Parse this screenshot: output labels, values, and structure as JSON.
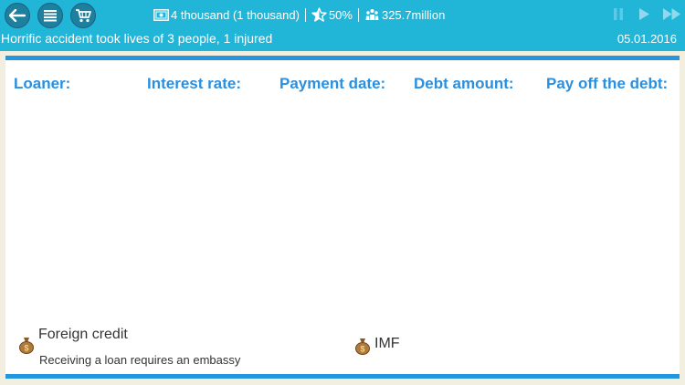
{
  "header": {
    "money": "4 thousand (1 thousand)",
    "approval": "50%",
    "population": "325.7million",
    "news": "Horrific accident took lives of 3 people, 1 injured",
    "date": "05.01.2016",
    "icons": [
      "back-arrow-icon",
      "menu-icon",
      "cart-icon",
      "money-icon",
      "star-icon",
      "people-icon",
      "pause-icon",
      "play-icon",
      "fast-forward-icon"
    ]
  },
  "columns": [
    "Loaner:",
    "Interest rate:",
    "Payment date:",
    "Debt amount:",
    "Pay off the debt:"
  ],
  "lenders": [
    {
      "name": "Foreign credit",
      "note": "Receiving a loan requires an embassy",
      "icon": "money-bag-icon"
    },
    {
      "name": "IMF",
      "icon": "money-bag-icon"
    }
  ],
  "colors": {
    "topbar": "#21b6d8",
    "accent": "#2596de",
    "header_text": "#2b8fde",
    "background": "#f3efe0"
  }
}
